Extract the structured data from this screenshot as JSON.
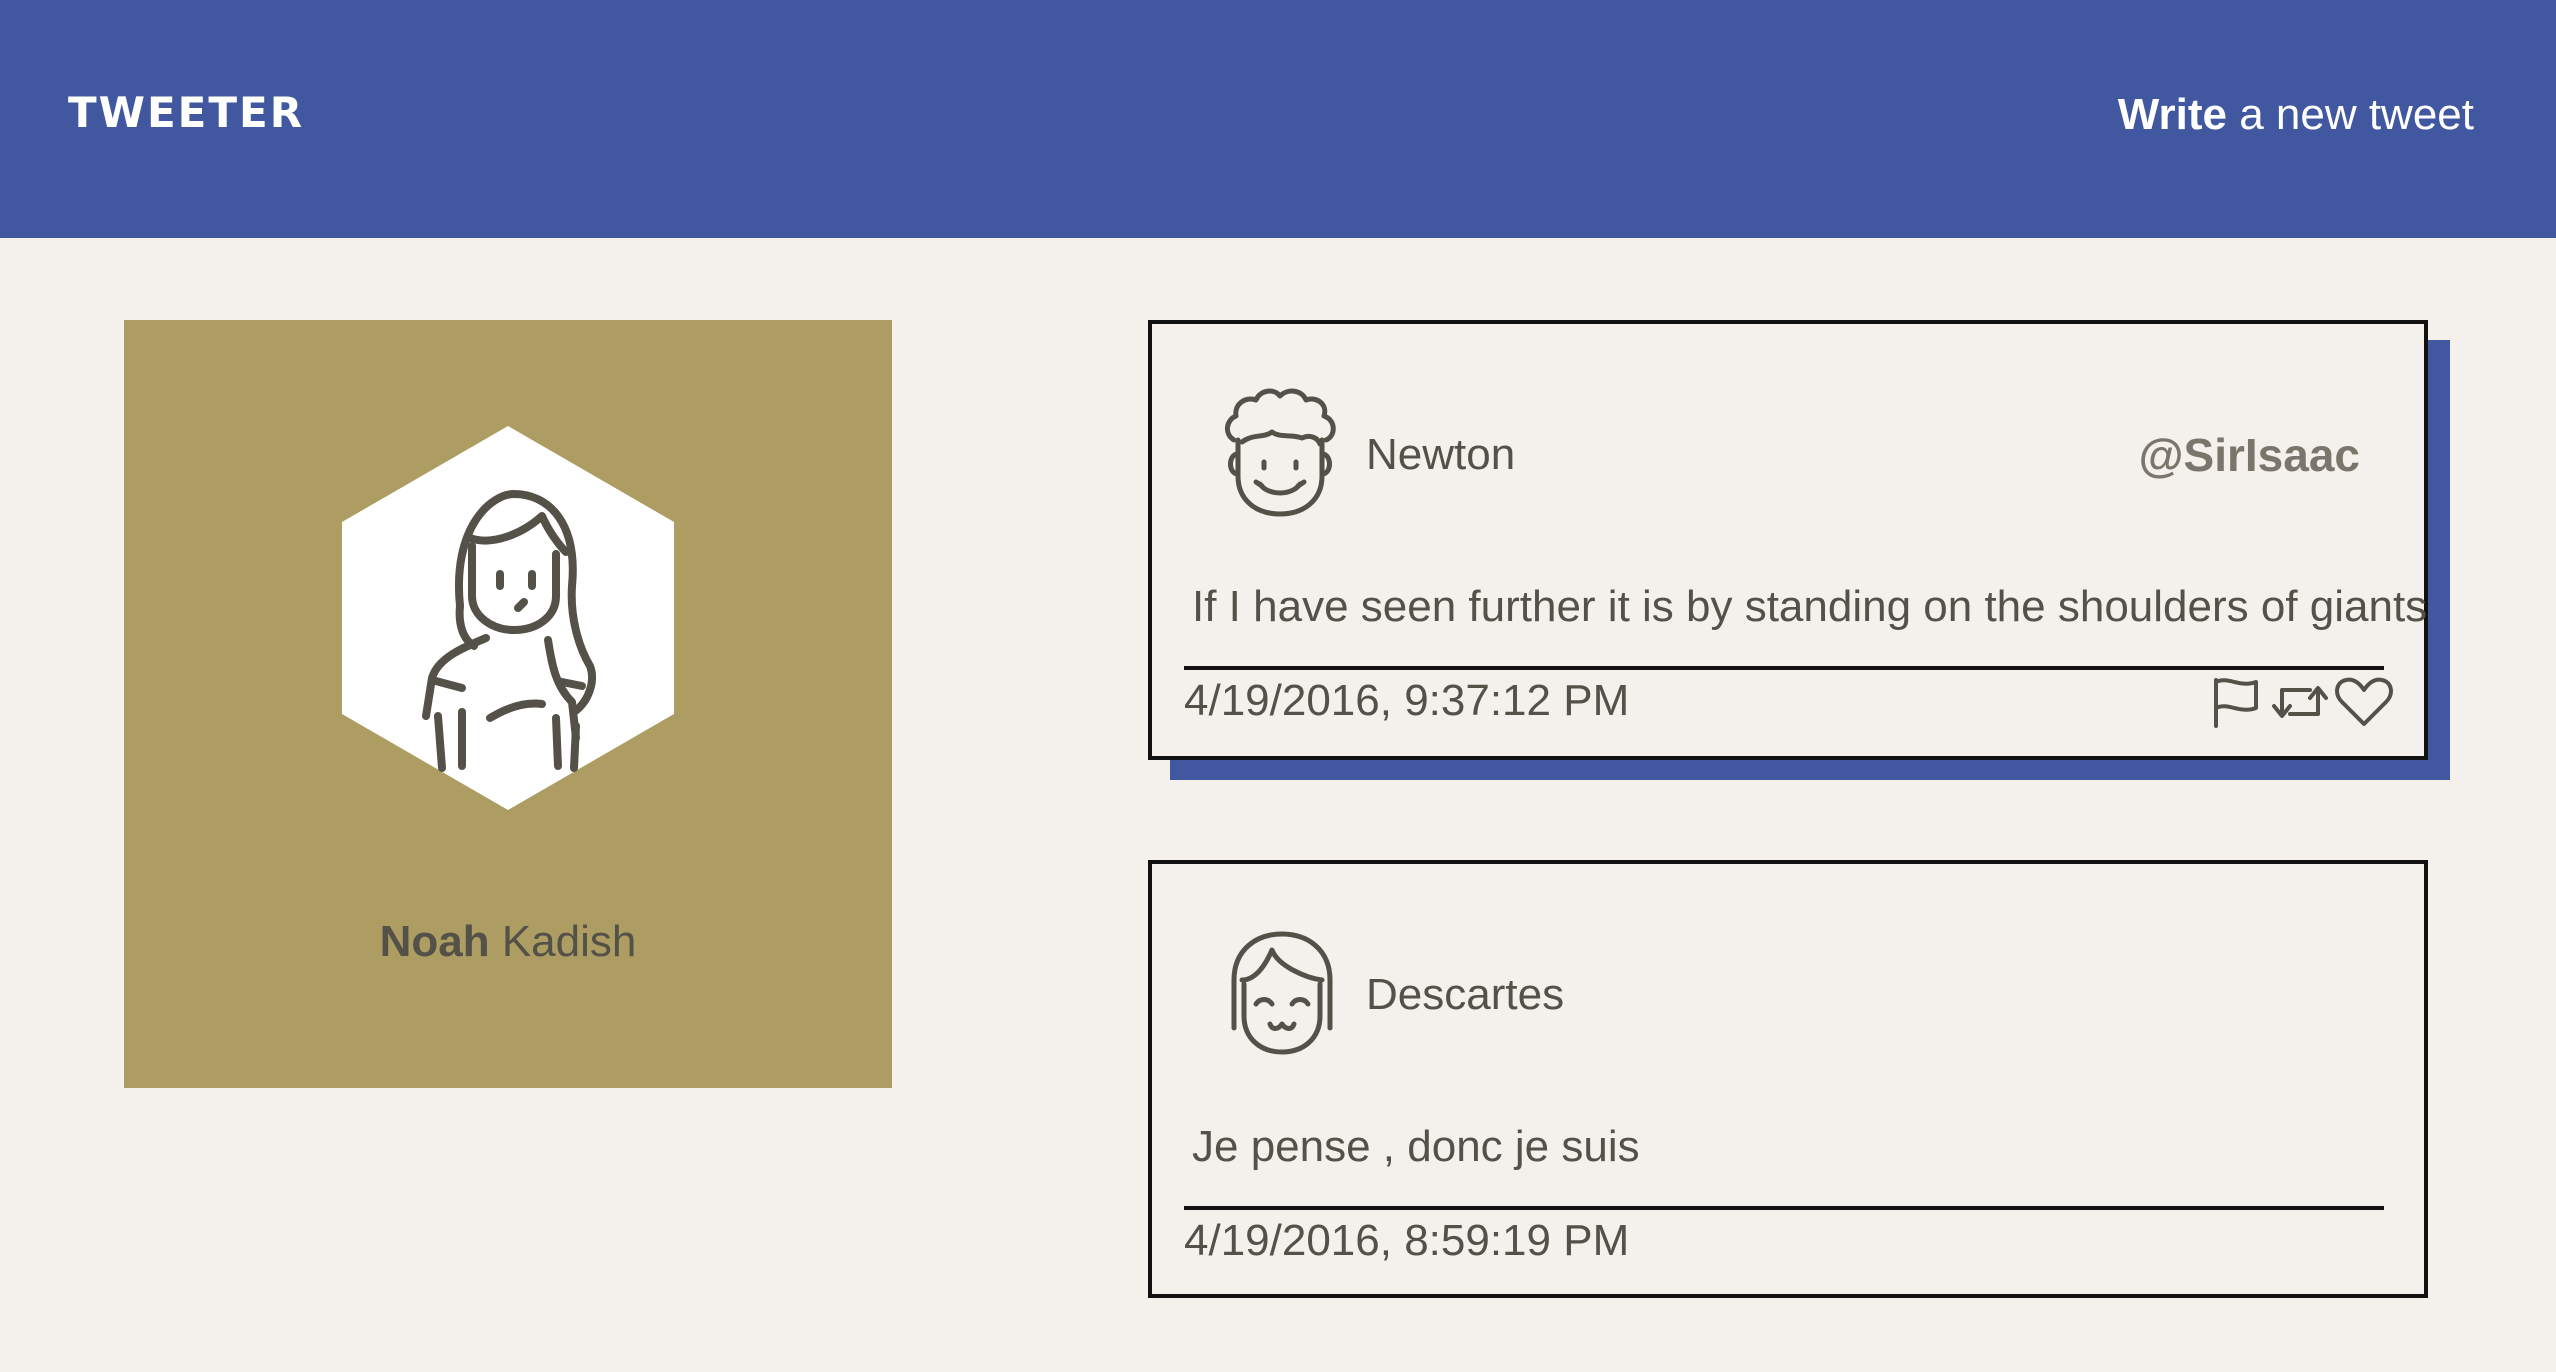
{
  "header": {
    "brand": "TWEETER",
    "compose_bold": "Write",
    "compose_rest": " a new tweet"
  },
  "profile": {
    "first_name": "Noah",
    "last_name": " Kadish",
    "avatar_icon": "woman-avatar-icon",
    "background_color": "#ae9d62"
  },
  "tweets": [
    {
      "author": "Newton",
      "handle": "@SirIsaac",
      "text": "If I have seen further it is by standing on the shoulders of giants",
      "timestamp": "4/19/2016, 9:37:12 PM",
      "avatar_icon": "curly-hair-man-avatar-icon",
      "actions": [
        "flag-icon",
        "retweet-icon",
        "heart-icon"
      ]
    },
    {
      "author": "Descartes",
      "text": "Je pense , donc je suis",
      "timestamp": "4/19/2016, 8:59:19 PM",
      "avatar_icon": "bob-hair-smiling-avatar-icon"
    }
  ],
  "colors": {
    "navbar": "#4158a0",
    "page_background": "#f4f1ec",
    "shadow_accent": "#4158a0",
    "text": "#545149"
  }
}
